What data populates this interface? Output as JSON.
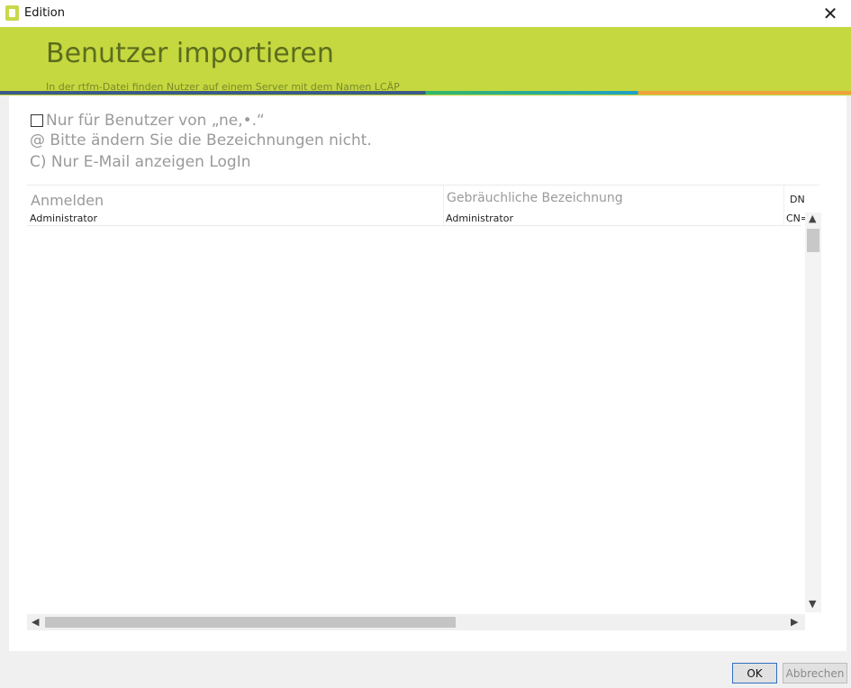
{
  "window": {
    "title": "Edition",
    "close_glyph": "✕"
  },
  "banner": {
    "title": "Benutzer importieren",
    "subtitle": "In der rtfm-Datei finden Nutzer auf einem Server mit dem Namen LCÄP"
  },
  "options": {
    "filter_label": "Nur für Benutzer von „ne,•.“",
    "rename_label": "@ Bitte ändern Sie die Bezeichnungen nicht.",
    "email_label": "C) Nur E-Mail anzeigen LogIn"
  },
  "grid": {
    "columns": [
      "Anmelden",
      "Gebräuchliche Bezeichnung",
      "DN"
    ],
    "rows": [
      {
        "login": "Administrator",
        "common_name": "Administrator",
        "dn": "CN="
      }
    ]
  },
  "buttons": {
    "ok": "OK",
    "cancel": "Abbrechen"
  },
  "colors": {
    "banner": "#c5d83f",
    "title_text": "#5c6d1e",
    "accent_blue": "#2f6fc2"
  },
  "icons": [
    "app-icon",
    "close-icon",
    "scroll-up-icon",
    "scroll-down-icon",
    "scroll-left-icon",
    "scroll-right-icon"
  ]
}
